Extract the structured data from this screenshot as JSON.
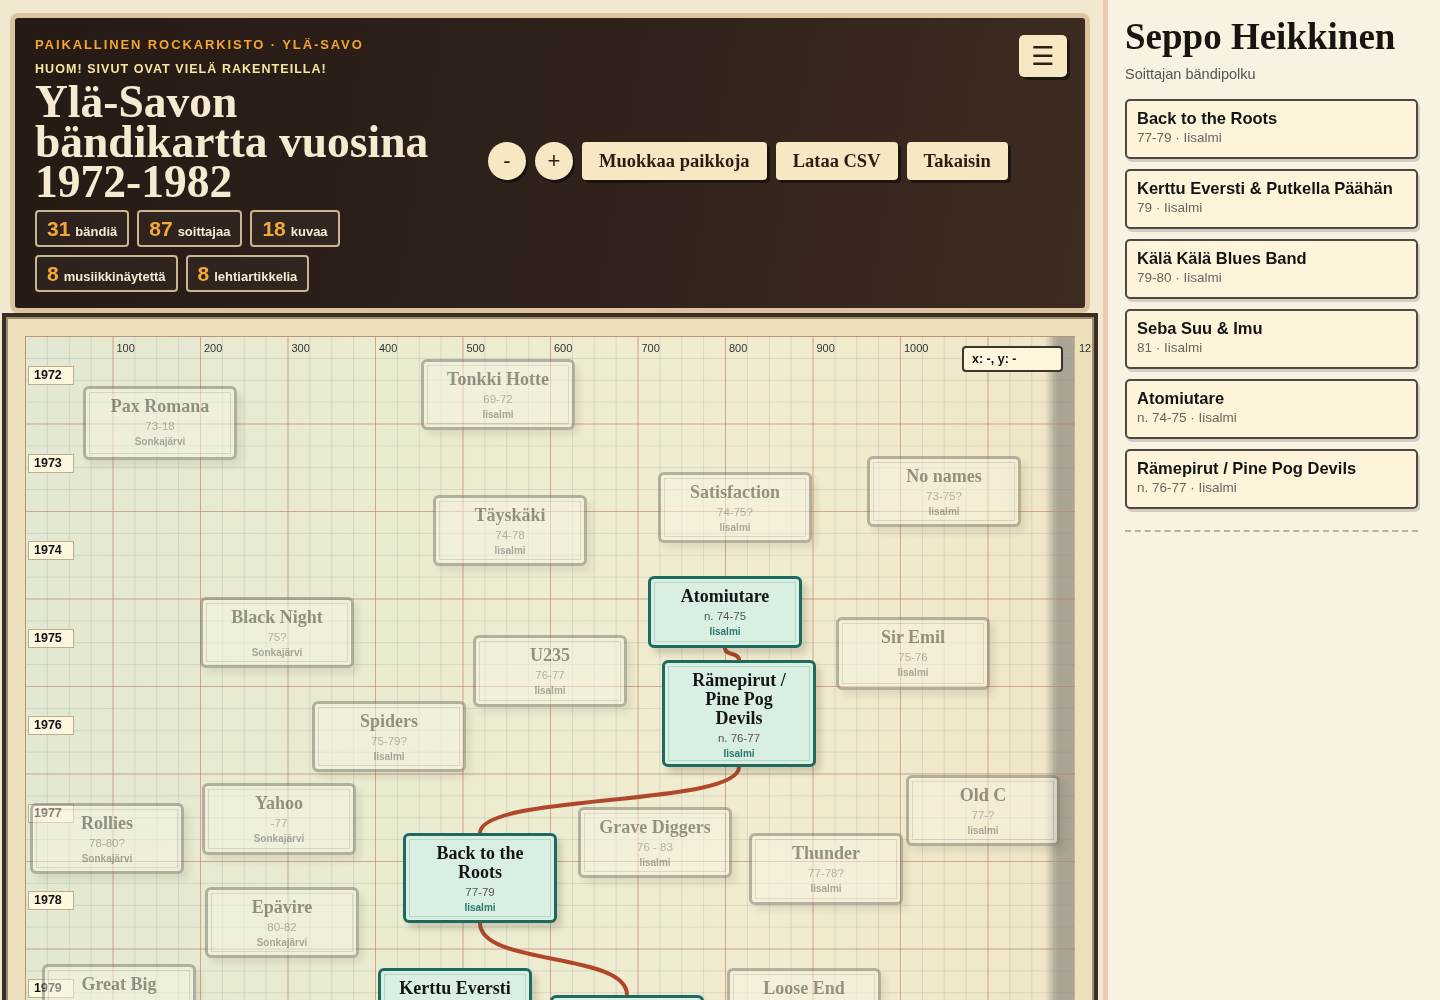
{
  "header": {
    "eyebrow": "PAIKALLINEN ROCKARKISTO · YLÄ-SAVO",
    "notice": "HUOM! SIVUT OVAT VIELÄ RAKENTEILLA!",
    "title": "Ylä-Savon bändikartta vuosina 1972-1982",
    "stats": [
      {
        "value": "31",
        "label": "bändiä"
      },
      {
        "value": "87",
        "label": "soittajaa"
      },
      {
        "value": "18",
        "label": "kuvaa"
      },
      {
        "value": "8",
        "label": "musiikkinäytettä"
      },
      {
        "value": "8",
        "label": "lehtiartikkelia"
      }
    ],
    "zoom_buttons": [
      "-",
      "+"
    ],
    "buttons": [
      "Muokkaa paikkoja",
      "Lataa CSV",
      "Takaisin"
    ],
    "menu_button": "☰"
  },
  "map": {
    "x_axis": [
      "100",
      "200",
      "300",
      "400",
      "500",
      "600",
      "700",
      "800",
      "900",
      "1000",
      "12"
    ],
    "years": [
      "1972",
      "1973",
      "1974",
      "1975",
      "1976",
      "1977",
      "1978",
      "1979"
    ],
    "cursor_readout": "x: -, y: -",
    "nodes": [
      {
        "title": "Tonkki Hotte",
        "years": "69-72",
        "place": "Iisalmi",
        "highlighted": false,
        "connected": false
      },
      {
        "title": "Pax Romana",
        "years": "73-18",
        "place": "Sonkajärvi",
        "highlighted": false,
        "connected": false
      },
      {
        "title": "No names",
        "years": "73-75?",
        "place": "Iisalmi",
        "highlighted": false,
        "connected": false
      },
      {
        "title": "Satisfaction",
        "years": "74-75?",
        "place": "Iisalmi",
        "highlighted": false,
        "connected": false
      },
      {
        "title": "Täyskäki",
        "years": "74-78",
        "place": "Iisalmi",
        "highlighted": false,
        "connected": false
      },
      {
        "title": "Atomiutare",
        "years": "n. 74-75",
        "place": "Iisalmi",
        "highlighted": true,
        "connected": true
      },
      {
        "title": "Black Night",
        "years": "75?",
        "place": "Sonkajärvi",
        "highlighted": false,
        "connected": false
      },
      {
        "title": "Sir Emil",
        "years": "75-76",
        "place": "Iisalmi",
        "highlighted": false,
        "connected": false
      },
      {
        "title": "U235",
        "years": "76-77",
        "place": "Iisalmi",
        "highlighted": false,
        "connected": false
      },
      {
        "title": "Spiders",
        "years": "75-79?",
        "place": "Iisalmi",
        "highlighted": false,
        "connected": false
      },
      {
        "title": "Rämepirut / Pine Pog Devils",
        "years": "n. 76-77",
        "place": "Iisalmi",
        "highlighted": true,
        "connected": true
      },
      {
        "title": "Old C",
        "years": "77-?",
        "place": "Iisalmi",
        "highlighted": false,
        "connected": false
      },
      {
        "title": "Rollies",
        "years": "78-80?",
        "place": "Sonkajärvi",
        "highlighted": false,
        "connected": false
      },
      {
        "title": "Yahoo",
        "years": "-77",
        "place": "Sonkajärvi",
        "highlighted": false,
        "connected": false
      },
      {
        "title": "Back to the Roots",
        "years": "77-79",
        "place": "Iisalmi",
        "highlighted": true,
        "connected": true
      },
      {
        "title": "Grave Diggers",
        "years": "76 - 83",
        "place": "Iisalmi",
        "highlighted": false,
        "connected": false
      },
      {
        "title": "Thunder",
        "years": "77-78?",
        "place": "Iisalmi",
        "highlighted": false,
        "connected": false
      },
      {
        "title": "Epävire",
        "years": "80-82",
        "place": "Sonkajärvi",
        "highlighted": false,
        "connected": false
      },
      {
        "title": "Great Big",
        "highlighted": false,
        "connected": false
      },
      {
        "title": "Kerttu Eversti",
        "highlighted": true,
        "connected": false
      },
      {
        "highlighted": true,
        "connected": false
      },
      {
        "title": "Loose End",
        "highlighted": false,
        "connected": false
      }
    ]
  },
  "sidebar": {
    "title": "Seppo Heikkinen",
    "subtitle": "Soittajan bändipolku",
    "bands": [
      {
        "name": "Back to the Roots",
        "meta": "77-79 · Iisalmi"
      },
      {
        "name": "Kerttu Eversti & Putkella Päähän",
        "meta": "79 · Iisalmi"
      },
      {
        "name": "Kälä Kälä Blues Band",
        "meta": "79-80 · Iisalmi"
      },
      {
        "name": "Seba Suu & Imu",
        "meta": "81 · Iisalmi"
      },
      {
        "name": "Atomiutare",
        "meta": "n. 74-75 · Iisalmi"
      },
      {
        "name": "Rämepirut / Pine Pog Devils",
        "meta": "n. 76-77 · Iisalmi"
      }
    ]
  }
}
